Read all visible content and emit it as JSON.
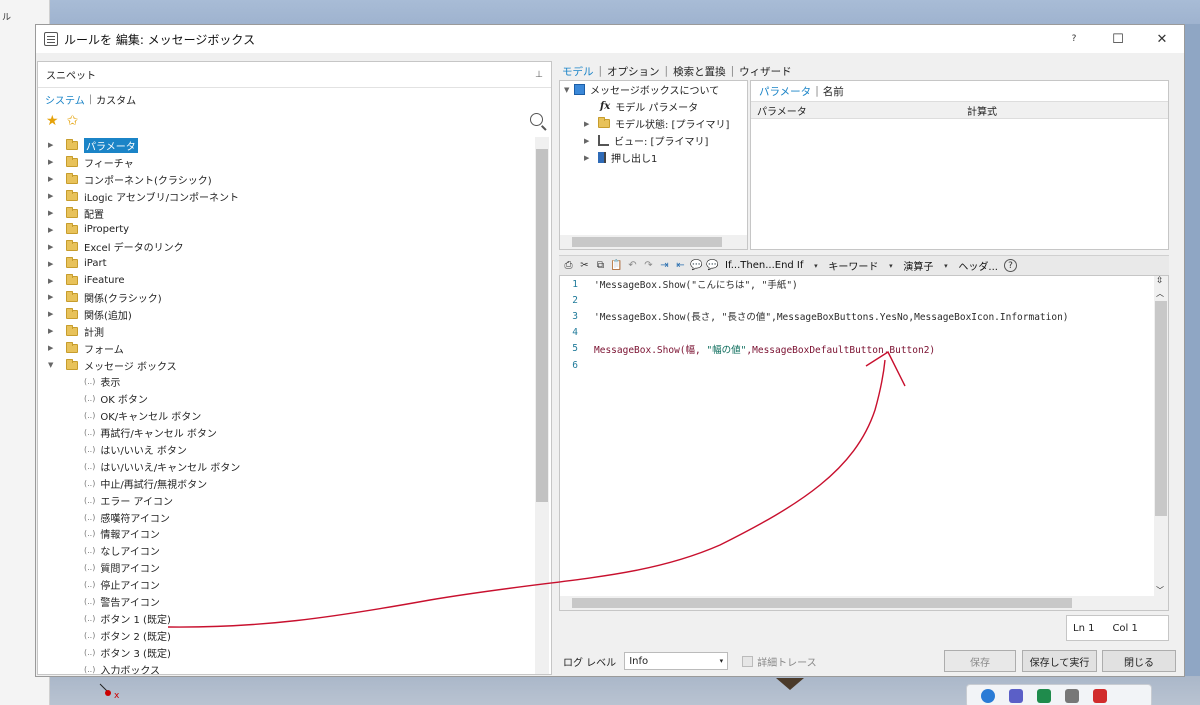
{
  "background": {
    "left_fragment": "ル"
  },
  "window": {
    "title": "ルールを 編集: メッセージボックス",
    "help": "?",
    "maximize": "☐",
    "close": "✕"
  },
  "snippets": {
    "header": "スニペット",
    "pin": "⊥",
    "tabs": {
      "system": "システム",
      "sep": "|",
      "custom": "カスタム"
    },
    "folders": [
      {
        "label": "パラメータ",
        "selected": true
      },
      {
        "label": "フィーチャ"
      },
      {
        "label": "コンポーネント(クラシック)"
      },
      {
        "label": "iLogic アセンブリ/コンポーネント"
      },
      {
        "label": "配置"
      },
      {
        "label": "iProperty"
      },
      {
        "label": "Excel データのリンク"
      },
      {
        "label": "iPart"
      },
      {
        "label": "iFeature"
      },
      {
        "label": "関係(クラシック)"
      },
      {
        "label": "関係(追加)"
      },
      {
        "label": "計測"
      },
      {
        "label": "フォーム"
      },
      {
        "label": "メッセージ ボックス",
        "expanded": true
      }
    ],
    "leaf_icon": "(..)",
    "message_box_items": [
      "表示",
      "OK ボタン",
      "OK/キャンセル ボタン",
      "再試行/キャンセル ボタン",
      "はい/いいえ ボタン",
      "はい/いいえ/キャンセル ボタン",
      "中止/再試行/無視ボタン",
      "エラー アイコン",
      "感嘆符アイコン",
      "情報アイコン",
      "なしアイコン",
      "質問アイコン",
      "停止アイコン",
      "警告アイコン",
      "ボタン 1 (既定)",
      "ボタン 2 (既定)",
      "ボタン 3 (既定)",
      "入力ボックス"
    ]
  },
  "right_tabs": [
    "モデル",
    "オプション",
    "検索と置換",
    "ウィザード"
  ],
  "model_tree": {
    "root": "メッセージボックスについて",
    "items": [
      "モデル パラメータ",
      "モデル状態: [プライマリ]",
      "ビュー: [プライマリ]",
      "押し出し1"
    ]
  },
  "params_panel": {
    "tabs": [
      "パラメータ",
      "名前"
    ],
    "columns": [
      "パラメータ",
      "計算式"
    ]
  },
  "toolbar": {
    "if_then": "If...Then...End If",
    "keyword": "キーワード",
    "operator": "演算子",
    "header": "ヘッダ...",
    "help": "?"
  },
  "code": [
    {
      "n": "1",
      "text": "'MessageBox.Show(\"こんにちは\", \"手紙\")"
    },
    {
      "n": "2",
      "text": ""
    },
    {
      "n": "3",
      "text": "'MessageBox.Show(長さ, \"長さの値\",MessageBoxButtons.YesNo,MessageBoxIcon.Information)"
    },
    {
      "n": "4",
      "text": ""
    },
    {
      "n": "5",
      "pre": "MessageBox.Show(幅, ",
      "str": "\"幅の値\"",
      "post": ",MessageBoxDefaultButton.Button2)"
    },
    {
      "n": "6",
      "text": ""
    }
  ],
  "status": {
    "ln": "Ln 1",
    "col": "Col 1"
  },
  "bottom": {
    "log_label": "ログ レベル",
    "log_value": "Info",
    "trace_label": "詳細トレース",
    "save": "保存",
    "save_run": "保存して実行",
    "close": "閉じる"
  },
  "colors": {
    "link": "#1b84c7",
    "selection": "#1b84c7",
    "annotation": "#c8102e"
  }
}
